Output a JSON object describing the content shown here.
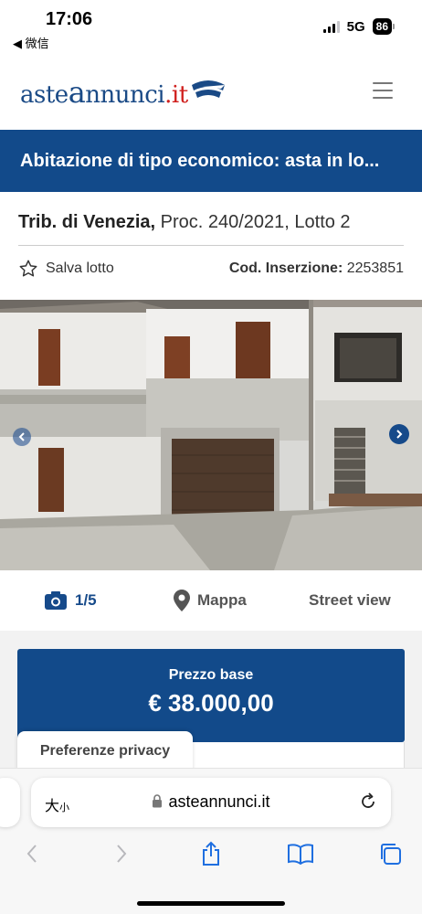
{
  "status_bar": {
    "time": "17:06",
    "back_app": "◀ 微信",
    "network": "5G",
    "battery": "86"
  },
  "header": {
    "logo": {
      "part1": "aste",
      "big_a": "a",
      "part2": "nnunci",
      "tld": ".it"
    },
    "menu_icon": "hamburger-menu-icon"
  },
  "listing": {
    "title": "Abitazione di tipo economico: asta in lo...",
    "court": "Trib. di Venezia,",
    "procedure": " Proc. 240/2021, Lotto 2",
    "save_label": "Salva lotto",
    "code_label": "Cod. Inserzione:",
    "code_value": " 2253851"
  },
  "media": {
    "photo_count": "1/5",
    "map_label": "Mappa",
    "street_view_label": "Street view"
  },
  "price": {
    "label": "Prezzo base",
    "value": "€ 38.000,00"
  },
  "privacy": {
    "tab_label": "Preferenze privacy"
  },
  "browser": {
    "text_size": "大",
    "text_size_small": "小",
    "url": "asteannunci.it"
  },
  "colors": {
    "brand_blue": "#124a8a",
    "logo_red": "#d0201e"
  }
}
